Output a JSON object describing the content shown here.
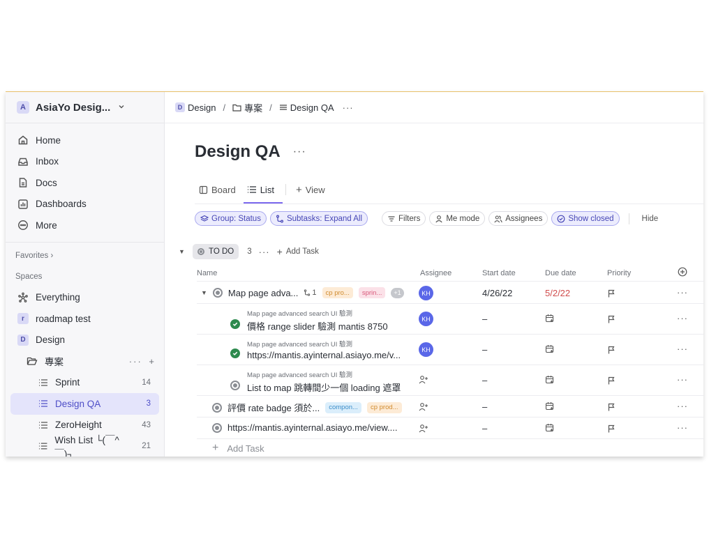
{
  "workspace": {
    "badge": "A",
    "name": "AsiaYo Desig..."
  },
  "nav": [
    {
      "label": "Home",
      "icon": "home-icon"
    },
    {
      "label": "Inbox",
      "icon": "inbox-icon"
    },
    {
      "label": "Docs",
      "icon": "docs-icon"
    },
    {
      "label": "Dashboards",
      "icon": "dashboards-icon"
    },
    {
      "label": "More",
      "icon": "more-icon"
    }
  ],
  "sidebar": {
    "favorites_label": "Favorites",
    "spaces_label": "Spaces",
    "spaces": [
      {
        "label": "Everything",
        "badge": ""
      },
      {
        "label": "roadmap test",
        "badge": "r"
      },
      {
        "label": "Design",
        "badge": "D"
      }
    ],
    "folder": {
      "label": "專案"
    },
    "lists": [
      {
        "label": "Sprint",
        "count": "14"
      },
      {
        "label": "Design QA",
        "count": "3"
      },
      {
        "label": "ZeroHeight",
        "count": "43"
      },
      {
        "label": "Wish List └(￣^￣)┐",
        "count": "21"
      }
    ]
  },
  "breadcrumb": {
    "space_badge": "D",
    "space": "Design",
    "folder": "專案",
    "list": "Design QA"
  },
  "page": {
    "title": "Design QA"
  },
  "views": {
    "board": "Board",
    "list": "List",
    "add_view": "View"
  },
  "toolbar": {
    "group": "Group: Status",
    "subtasks": "Subtasks: Expand All",
    "filters": "Filters",
    "me_mode": "Me mode",
    "assignees": "Assignees",
    "show_closed": "Show closed",
    "hide": "Hide"
  },
  "group": {
    "status": "TO DO",
    "count": "3",
    "add_task": "Add Task"
  },
  "columns": {
    "name": "Name",
    "assignee": "Assignee",
    "start": "Start date",
    "due": "Due date",
    "priority": "Priority"
  },
  "tasks": {
    "main": {
      "title": "Map page adva...",
      "subtask_count": "1",
      "tags": [
        "cp pro...",
        "sprin...",
        "+1"
      ],
      "assignee": "KH",
      "start": "4/26/22",
      "due": "5/2/22"
    },
    "subtasks": [
      {
        "parent": "Map page advanced search UI 驗測",
        "title": "價格 range slider 驗測 mantis 8750",
        "assignee": "KH",
        "start": "–"
      },
      {
        "parent": "Map page advanced search UI 驗測",
        "title": "https://mantis.ayinternal.asiayo.me/v...",
        "assignee": "KH",
        "start": "–"
      },
      {
        "parent": "Map page advanced search UI 驗測",
        "title": "List to map 跳轉間少一個 loading 遮罩",
        "start": "–"
      }
    ],
    "others": [
      {
        "title": "評價 rate badge 須於...",
        "tags": [
          "compon...",
          "cp prod..."
        ],
        "start": "–"
      },
      {
        "title": "https://mantis.ayinternal.asiayo.me/view....",
        "start": "–"
      }
    ],
    "add_task": "Add Task"
  },
  "colors": {
    "accent": "#7b68ee",
    "overdue": "#d04c4c",
    "done": "#2d8a4e",
    "avatar": "#5a67e8"
  }
}
